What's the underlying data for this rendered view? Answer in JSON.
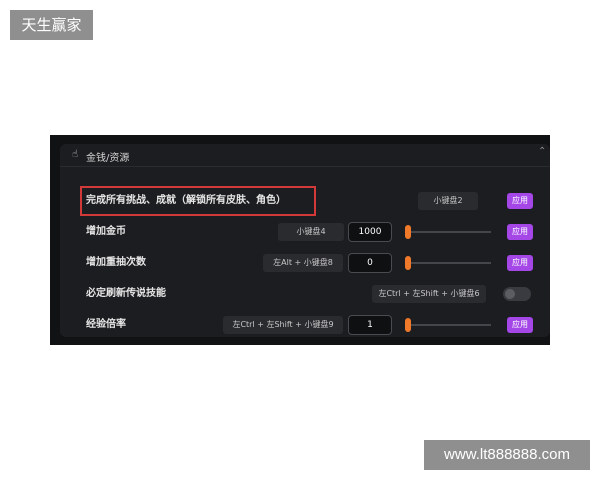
{
  "watermarks": {
    "top_left": "天生赢家",
    "bottom_right": "www.lt888888.com"
  },
  "panel": {
    "icon": "hand-icon",
    "title": "金钱/资源",
    "collapse_icon": "chevron-up-icon",
    "rows": [
      {
        "label": "完成所有挑战、成就（解锁所有皮肤、角色）",
        "hotkey": "小键盘2",
        "apply": "应用",
        "highlighted": true
      },
      {
        "label": "增加金币",
        "hotkey": "小键盘4",
        "value": "1000",
        "slider_level": 0.02,
        "apply": "应用"
      },
      {
        "label": "增加重抽次数",
        "hotkey": "左Alt + 小键盘8",
        "value": "0",
        "slider_level": 0.0,
        "apply": "应用"
      },
      {
        "label": "必定刷新传说技能",
        "hotkey": "左Ctrl + 左Shift + 小键盘6",
        "toggle_on": false
      },
      {
        "label": "经验倍率",
        "hotkey": "左Ctrl + 左Shift + 小键盘9",
        "value": "1",
        "slider_level": 0.02,
        "apply": "应用"
      }
    ]
  },
  "colors": {
    "accent_purple": "#a447e6",
    "slider_orange": "#f07a2a",
    "highlight_red": "#d23a3a",
    "panel_bg": "#1c1d20"
  }
}
